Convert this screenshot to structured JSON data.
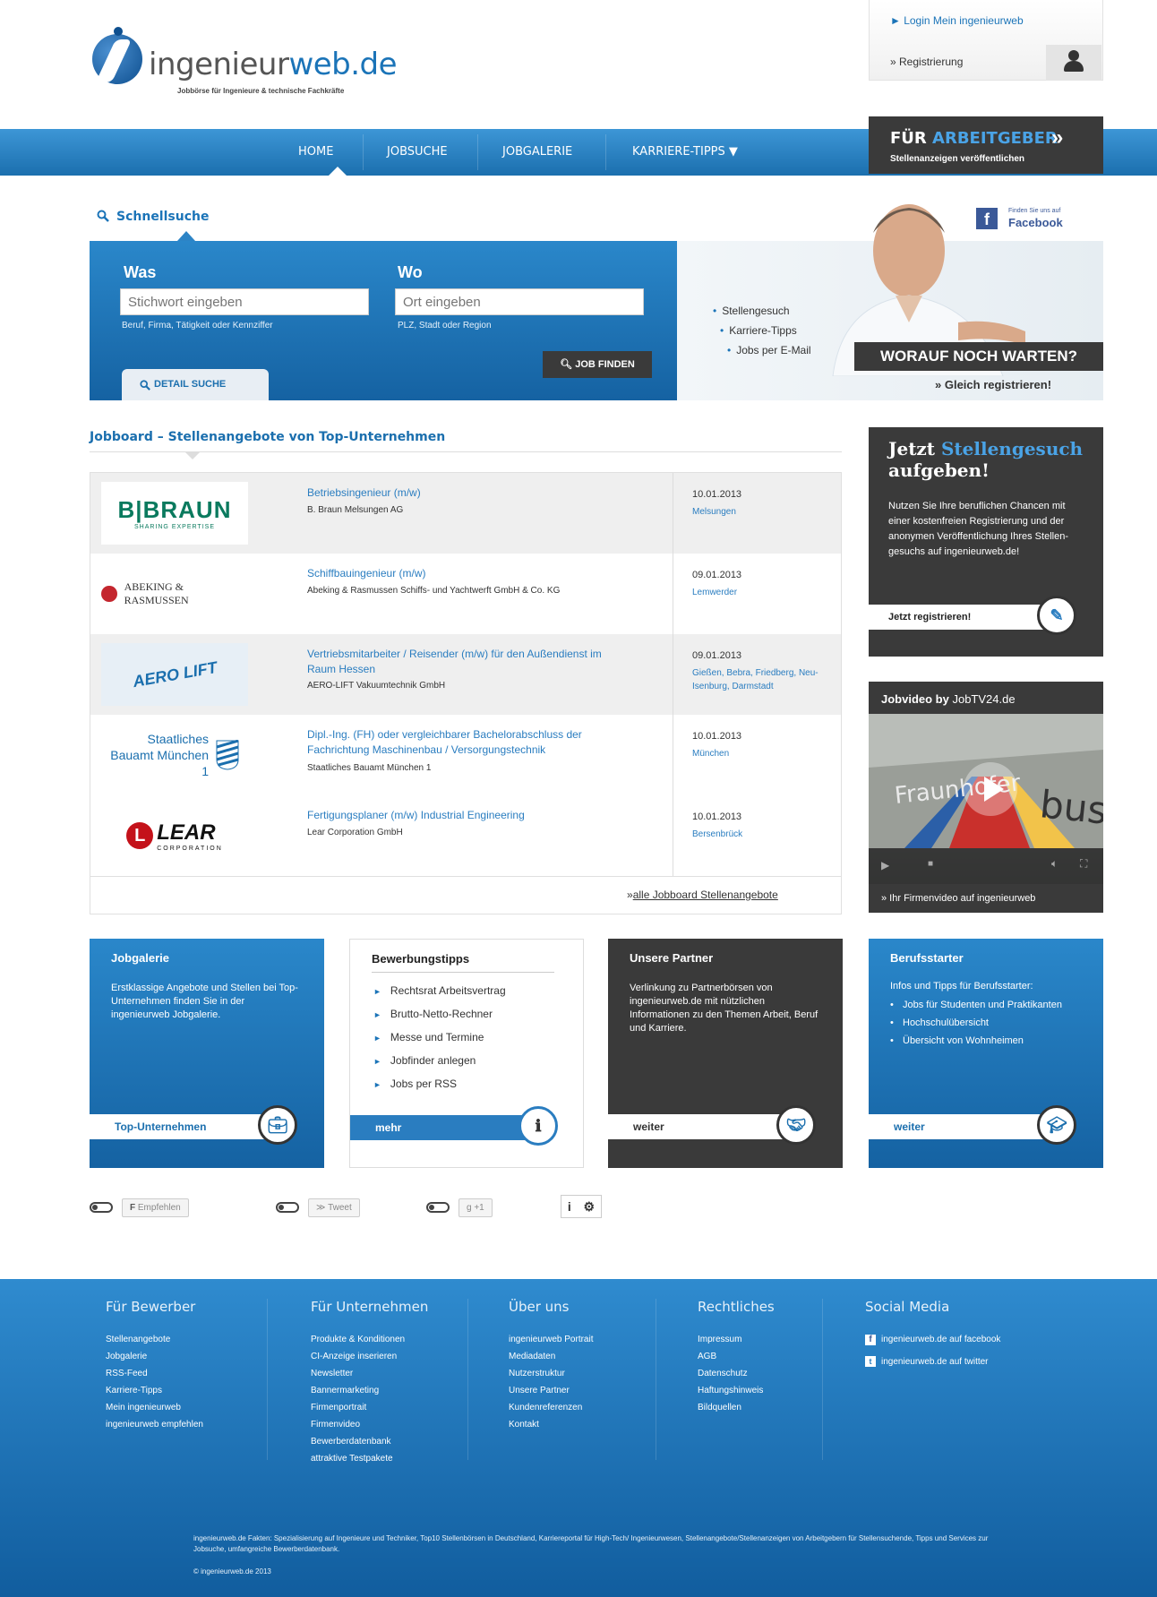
{
  "header": {
    "logo_text_1": "ingenieur",
    "logo_text_2": "web.de",
    "tagline": "Jobbörse für Ingenieure & technische Fachkräfte",
    "login_link": "►  Login Mein ingenieurweb",
    "register_link": "»  Registrierung"
  },
  "nav": {
    "items": [
      "HOME",
      "JOBSUCHE",
      "JOBGALERIE",
      "KARRIERE-TIPPS ▼"
    ],
    "employer_title_1": "FÜR ",
    "employer_title_2": "ARBEITGEBER",
    "employer_arrow": "»",
    "employer_sub": "Stellenanzeigen veröffentlichen"
  },
  "quicksearch": {
    "title": "Schnellsuche",
    "was_label": "Was",
    "wo_label": "Wo",
    "was_placeholder": "Stichwort eingeben",
    "wo_placeholder": "Ort eingeben",
    "was_hint": "Beruf, Firma, Tätigkeit oder Kennziffer",
    "wo_hint": "PLZ, Stadt oder Region",
    "job_button": "JOB FINDEN",
    "detail_tab": "DETAIL SUCHE"
  },
  "promo": {
    "facebook_small": "Finden Sie uns auf",
    "facebook_big": "Facebook",
    "bullets": [
      "Stellengesuch",
      "Karriere-Tipps",
      "Jobs per E-Mail"
    ],
    "cta": "WORAUF NOCH WARTEN?",
    "sub_cta": "»  Gleich registrieren!"
  },
  "jobboard": {
    "title": "Jobboard – Stellenangebote von Top-Unternehmen",
    "all_link": "alle Jobboard Stellenangebote",
    "all_prefix": "»  ",
    "rows": [
      {
        "logo": "B|BRAUN",
        "logo_sub": "SHARING EXPERTISE",
        "title": "Betriebsingenieur (m/w)",
        "company": "B. Braun Melsungen AG",
        "date": "10.01.2013",
        "location": "Melsungen"
      },
      {
        "logo": "ABEKING & RASMUSSEN",
        "logo_sub": "",
        "title": "Schiffbauingenieur (m/w)",
        "company": "Abeking & Rasmussen Schiffs- und Yachtwerft GmbH & Co. KG",
        "date": "09.01.2013",
        "location": "Lemwerder"
      },
      {
        "logo": "AERO LIFT",
        "logo_sub": "",
        "title": "Vertriebsmitarbeiter / Reisender (m/w) für den Außendienst im Raum Hessen",
        "company": "AERO-LIFT Vakuumtechnik GmbH",
        "date": "09.01.2013",
        "location": "Gießen, Bebra, Friedberg, Neu-Isenburg, Darmstadt"
      },
      {
        "logo": "Staatliches Bauamt München 1",
        "logo_sub": "",
        "title": "Dipl.-Ing. (FH) oder vergleichbarer Bachelorabschluss der Fachrichtung Maschinenbau / Versorgungstechnik",
        "company": "Staatliches Bauamt München 1",
        "date": "10.01.2013",
        "location": "München"
      },
      {
        "logo": "LEAR",
        "logo_sub": "CORPORATION",
        "title": "Fertigungsplaner (m/w) Industrial Engineering",
        "company": "Lear Corporation GmbH",
        "date": "10.01.2013",
        "location": "Bersenbrück"
      }
    ]
  },
  "sidebar": {
    "gesuch_title_1": "Jetzt ",
    "gesuch_title_2": "Stellengesuch",
    "gesuch_title_3": "aufgeben!",
    "gesuch_text": "Nutzen Sie Ihre beruflichen Chancen mit einer kostenfreien Registrierung und der anonymen Veröffentlichung Ihres Stellen-gesuchs auf ingenieurweb.de!",
    "gesuch_button": "Jetzt registrieren!",
    "video_title_1": "Jobvideo by ",
    "video_title_2": "JobTV24.de",
    "video_caption": "»  Ihr Firmenvideo auf ingenieurweb"
  },
  "boxes": {
    "jobgalerie": {
      "title": "Jobgalerie",
      "text": "Erstklassige Angebote und Stellen bei Top-Unternehmen finden Sie in der ingenieurweb Jobgalerie.",
      "button": "Top-Unternehmen"
    },
    "bewerbung": {
      "title": "Bewerbungstipps",
      "items": [
        "Rechtsrat Arbeitsvertrag",
        "Brutto-Netto-Rechner",
        "Messe und Termine",
        "Jobfinder anlegen",
        "Jobs per RSS"
      ],
      "button": "mehr"
    },
    "partner": {
      "title": "Unsere Partner",
      "text": "Verlinkung zu Partnerbörsen von ingenieurweb.de mit nützlichen Informationen zu den Themen Arbeit, Beruf und Karriere.",
      "button": "weiter"
    },
    "starter": {
      "title": "Berufsstarter",
      "intro": "Infos und Tipps für Berufsstarter:",
      "items": [
        "Jobs für Studenten und Praktikanten",
        "Hochschulübersicht",
        "Übersicht von Wohnheimen"
      ],
      "button": "weiter"
    }
  },
  "social": {
    "empfehlen": "Empfehlen",
    "tweet": "Tweet",
    "gplus": "+1"
  },
  "footer": {
    "columns": [
      {
        "title": "Für Bewerber",
        "links": [
          "Stellenangebote",
          "Jobgalerie",
          "RSS-Feed",
          "Karriere-Tipps",
          "Mein ingenieurweb",
          "ingenieurweb empfehlen"
        ]
      },
      {
        "title": "Für Unternehmen",
        "links": [
          "Produkte & Konditionen",
          "CI-Anzeige inserieren",
          "Newsletter",
          "Bannermarketing",
          "Firmenportrait",
          "Firmenvideo",
          "Bewerberdatenbank",
          "attraktive Testpakete"
        ]
      },
      {
        "title": "Über uns",
        "links": [
          "ingenieurweb Portrait",
          "Mediadaten",
          "Nutzerstruktur",
          "Unsere Partner",
          "Kundenreferenzen",
          "Kontakt"
        ]
      },
      {
        "title": "Rechtliches",
        "links": [
          "Impressum",
          "AGB",
          "Datenschutz",
          "Haftungshinweis",
          "Bildquellen"
        ]
      },
      {
        "title": "Social Media",
        "links": [
          "ingenieurweb.de auf facebook",
          "ingenieurweb.de auf twitter"
        ]
      }
    ],
    "about": "ingenieurweb.de Fakten: Spezialisierung auf Ingenieure und Techniker, Top10 Stellenbörsen in Deutschland, Karriereportal für High-Tech/ Ingenieurwesen, Stellenangebote/Stellenanzeigen von Arbeitgebern für Stellensuchende, Tipps und Services zur Jobsuche, umfangreiche Bewerberdatenbank.",
    "copyright": "© ingenieurweb.de 2013"
  }
}
